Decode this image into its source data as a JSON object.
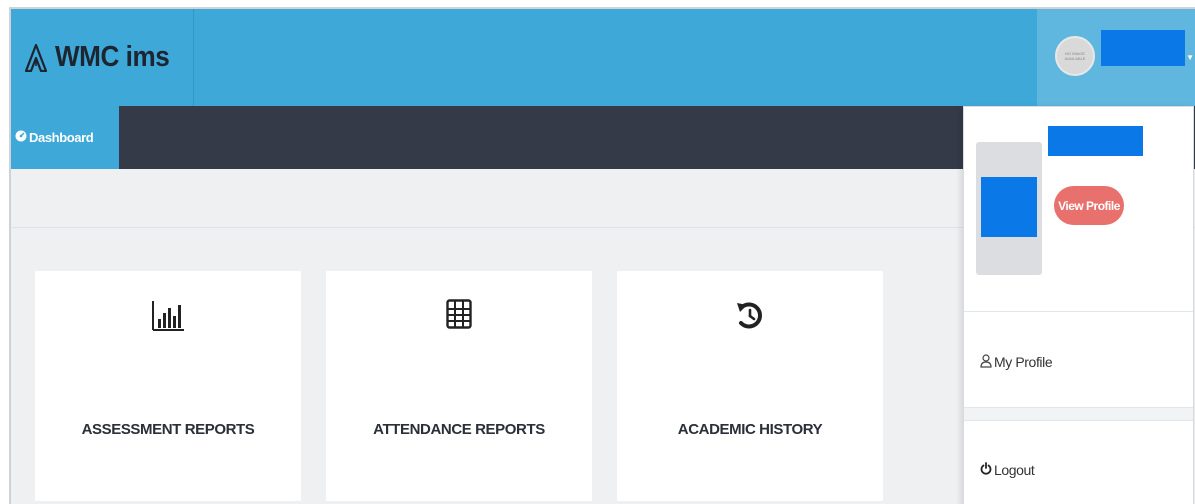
{
  "header": {
    "app_name": "WMC ims",
    "avatar_text": "NO IMAGE AVAILABLE"
  },
  "nav": {
    "dashboard_label": "Dashboard"
  },
  "cards": [
    {
      "label": "ASSESSMENT REPORTS",
      "icon": "bar-chart-icon"
    },
    {
      "label": "ATTENDANCE REPORTS",
      "icon": "grid-table-icon"
    },
    {
      "label": "ACADEMIC HISTORY",
      "icon": "history-icon"
    }
  ],
  "dropdown": {
    "view_profile_label": "View Profile",
    "my_profile_label": "My Profile",
    "logout_label": "Logout"
  },
  "colors": {
    "header_blue": "#3ea8d8",
    "nav_dark": "#343a48",
    "redaction_blue": "#0a78e6",
    "view_profile_red": "#e8706d"
  }
}
